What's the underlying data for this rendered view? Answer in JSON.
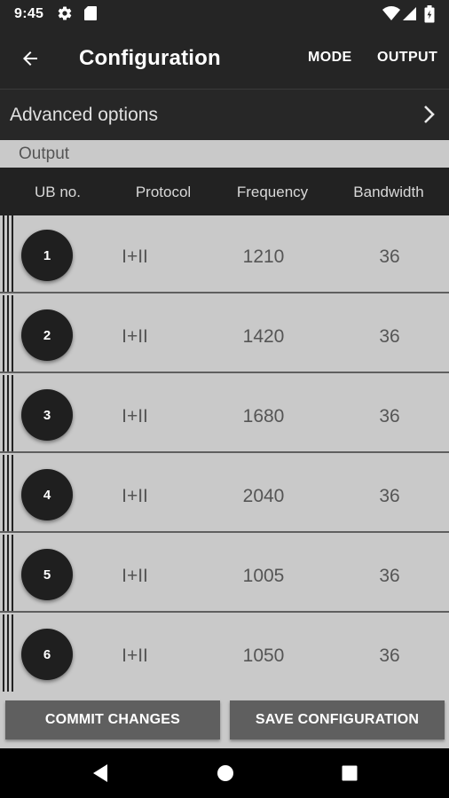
{
  "status_bar": {
    "time": "9:45",
    "left_icons": [
      "gear-icon",
      "sd-card-icon"
    ],
    "right_icons": [
      "wifi-icon",
      "signal-icon",
      "battery-icon"
    ]
  },
  "app_bar": {
    "title": "Configuration",
    "actions": [
      "MODE",
      "OUTPUT"
    ]
  },
  "advanced": {
    "label": "Advanced options"
  },
  "section": {
    "label": "Output"
  },
  "table": {
    "columns": [
      "UB no.",
      "Protocol",
      "Frequency",
      "Bandwidth"
    ],
    "rows": [
      {
        "ub": "1",
        "protocol": "I+II",
        "frequency": "1210",
        "bandwidth": "36"
      },
      {
        "ub": "2",
        "protocol": "I+II",
        "frequency": "1420",
        "bandwidth": "36"
      },
      {
        "ub": "3",
        "protocol": "I+II",
        "frequency": "1680",
        "bandwidth": "36"
      },
      {
        "ub": "4",
        "protocol": "I+II",
        "frequency": "2040",
        "bandwidth": "36"
      },
      {
        "ub": "5",
        "protocol": "I+II",
        "frequency": "1005",
        "bandwidth": "36"
      },
      {
        "ub": "6",
        "protocol": "I+II",
        "frequency": "1050",
        "bandwidth": "36"
      }
    ]
  },
  "buttons": {
    "commit": "COMMIT CHANGES",
    "save": "SAVE CONFIGURATION"
  },
  "colors": {
    "app_bar": "#252525",
    "row_bg": "#c9c9c9",
    "badge": "#1f1f1f",
    "button": "#5f5f5f",
    "nav_bar": "#000000"
  }
}
